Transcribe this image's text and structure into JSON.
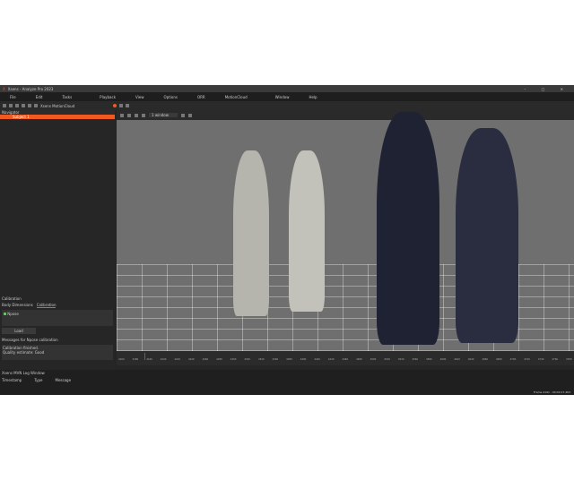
{
  "window": {
    "title": "Xsens - Analyze Pro 2023",
    "controls": [
      "minimize",
      "maximize",
      "close"
    ]
  },
  "menu": [
    "File",
    "Edit",
    "Tasks",
    "Playback",
    "View",
    "Options",
    "ORR",
    "MotionCloud",
    "Window",
    "Help"
  ],
  "toolbar": {
    "motioncloud_label": "Xsens MotionCloud"
  },
  "navigator": {
    "title": "Navigator",
    "subject": "Subject 1"
  },
  "viewport": {
    "view_select": "1 window"
  },
  "timeline": {
    "ticks": [
      "4160",
      "4180",
      "4190",
      "4200",
      "4220",
      "4240",
      "4260",
      "4280",
      "4300",
      "4320",
      "4340",
      "4360",
      "4380",
      "4400",
      "4420",
      "4440",
      "4460",
      "4480",
      "4500",
      "4520",
      "4540",
      "4560",
      "4580",
      "4600",
      "4620",
      "4640",
      "4660",
      "4680",
      "4700",
      "4720",
      "4740",
      "4760",
      "4780"
    ],
    "cursor_fraction": 0.06
  },
  "calibration": {
    "title": "Calibration",
    "tabs": [
      "Body Dimensions",
      "Calibration"
    ],
    "item": "Npose",
    "load_label": "Load",
    "messages_label": "Messages for Npose calibration",
    "messages": "Calibration finished.\nQuality estimate: Good"
  },
  "log": {
    "title": "Xsens MVN Log Window",
    "columns": [
      "Timestamp",
      "Type",
      "Message"
    ]
  },
  "status": {
    "frame": "Frame 4191 : 00:00:17.463"
  },
  "colors": {
    "accent": "#f05a22"
  }
}
